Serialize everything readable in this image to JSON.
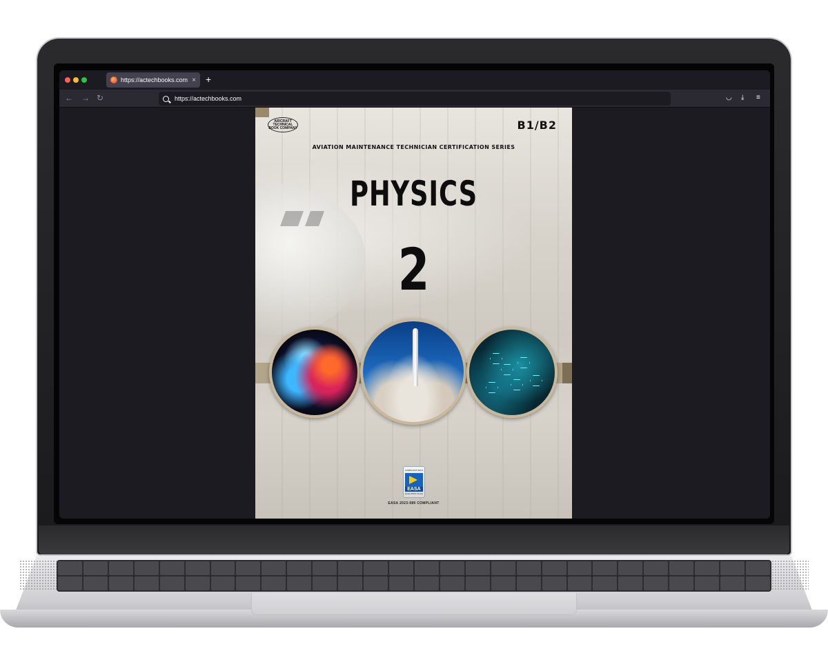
{
  "browser": {
    "tab": {
      "title": "https://actechbooks.com",
      "close": "×"
    },
    "new_tab": "+",
    "nav": {
      "back": "←",
      "forward": "→",
      "reload": "↻"
    },
    "url": "https://actechbooks.com",
    "toolbar": {
      "pocket": "◡",
      "downloads": "⤓",
      "menu": "≡"
    }
  },
  "cover": {
    "logo_text": "AIRCRAFT TECHNICAL BOOK COMPANY",
    "level": "B1/B2",
    "series": "AVIATION MAINTENANCE TECHNICIAN CERTIFICATION SERIES",
    "title": "PHYSICS",
    "volume": "2",
    "badge": {
      "top": "COMPLIANT WITH",
      "name": "EASA",
      "bottom": "EASA PART 66 (M)"
    },
    "compliance": "EASA 2023-989 COMPLIANT"
  },
  "colors": {
    "browser_bg": "#1c1b22",
    "tab_active": "#42414d",
    "cover_band": "#8e8167"
  }
}
